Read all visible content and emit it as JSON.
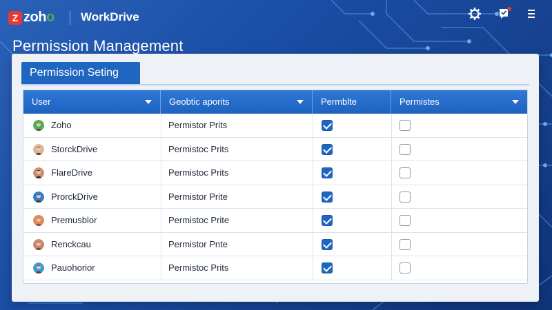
{
  "brand": {
    "badge": "Z",
    "name_left": "zoh",
    "name_right": "o",
    "app": "WorkDrive"
  },
  "colors": {
    "accent": "#1f66c1",
    "brand_red": "#e53935",
    "brand_green": "#4caf50"
  },
  "header": {
    "icons": [
      "settings-icon",
      "notification-icon",
      "menu-icon"
    ]
  },
  "page": {
    "title": "Permission Management"
  },
  "panel": {
    "tab_label": "Permission Seting"
  },
  "table": {
    "columns": [
      {
        "label": "User",
        "has_dropdown": true
      },
      {
        "label": "Geobtic aporits",
        "has_dropdown": true
      },
      {
        "label": "Permblte",
        "has_dropdown": false
      },
      {
        "label": "Permistes",
        "has_dropdown": true
      }
    ],
    "rows": [
      {
        "user": "Zoho",
        "permission": "Permistor Prits",
        "permblte": true,
        "permistes": false
      },
      {
        "user": "StorckDrive",
        "permission": "Permistoc Prits",
        "permblte": true,
        "permistes": false
      },
      {
        "user": "FlareDrive",
        "permission": "Permistoc Prits",
        "permblte": true,
        "permistes": false
      },
      {
        "user": "ProrckDrive",
        "permission": "Permistor Prite",
        "permblte": true,
        "permistes": false
      },
      {
        "user": "Premusblor",
        "permission": "Permistoc Prite",
        "permblte": true,
        "permistes": false
      },
      {
        "user": "Renckcau",
        "permission": "Permistor Pnte",
        "permblte": true,
        "permistes": false
      },
      {
        "user": "Pauohorior",
        "permission": "Permistoc Prits",
        "permblte": true,
        "permistes": false
      }
    ]
  }
}
